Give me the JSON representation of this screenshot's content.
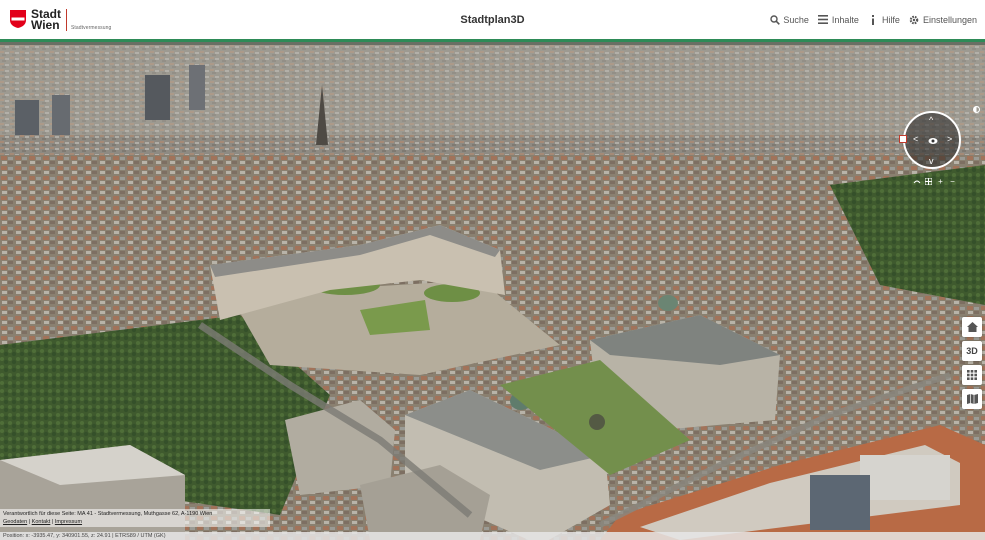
{
  "header": {
    "logo": {
      "line1": "Stadt",
      "line2": "Wien",
      "department": "Stadtvermessung"
    },
    "title": "Stadtplan3D",
    "nav": [
      {
        "icon": "search-icon",
        "label": "Suche"
      },
      {
        "icon": "menu-icon",
        "label": "Inhalte"
      },
      {
        "icon": "info-icon",
        "label": "Hilfe"
      },
      {
        "icon": "gear-icon",
        "label": "Einstellungen"
      }
    ]
  },
  "map": {
    "view": "3D aerial city view",
    "compass": {
      "icon": "compass-icon"
    },
    "side_buttons": [
      {
        "icon": "home-icon",
        "label": ""
      },
      {
        "icon": "3d-icon",
        "label": "3D"
      },
      {
        "icon": "grid-icon",
        "label": ""
      },
      {
        "icon": "map-icon",
        "label": ""
      }
    ]
  },
  "footer": {
    "responsible": "Verantwortlich für diese Seite: MA 41 - Stadtvermessung, Muthgasse 62, A-1190 Wien",
    "links": [
      "Geodaten",
      "Kontakt",
      "Impressum"
    ],
    "coordinates": "Position: x: -3935.47, y: 340901.55, z: 24.91 | ETRS89 / UTM (GK) "
  },
  "colors": {
    "accent": "#2e8b57",
    "brand_red": "#e2001a"
  }
}
